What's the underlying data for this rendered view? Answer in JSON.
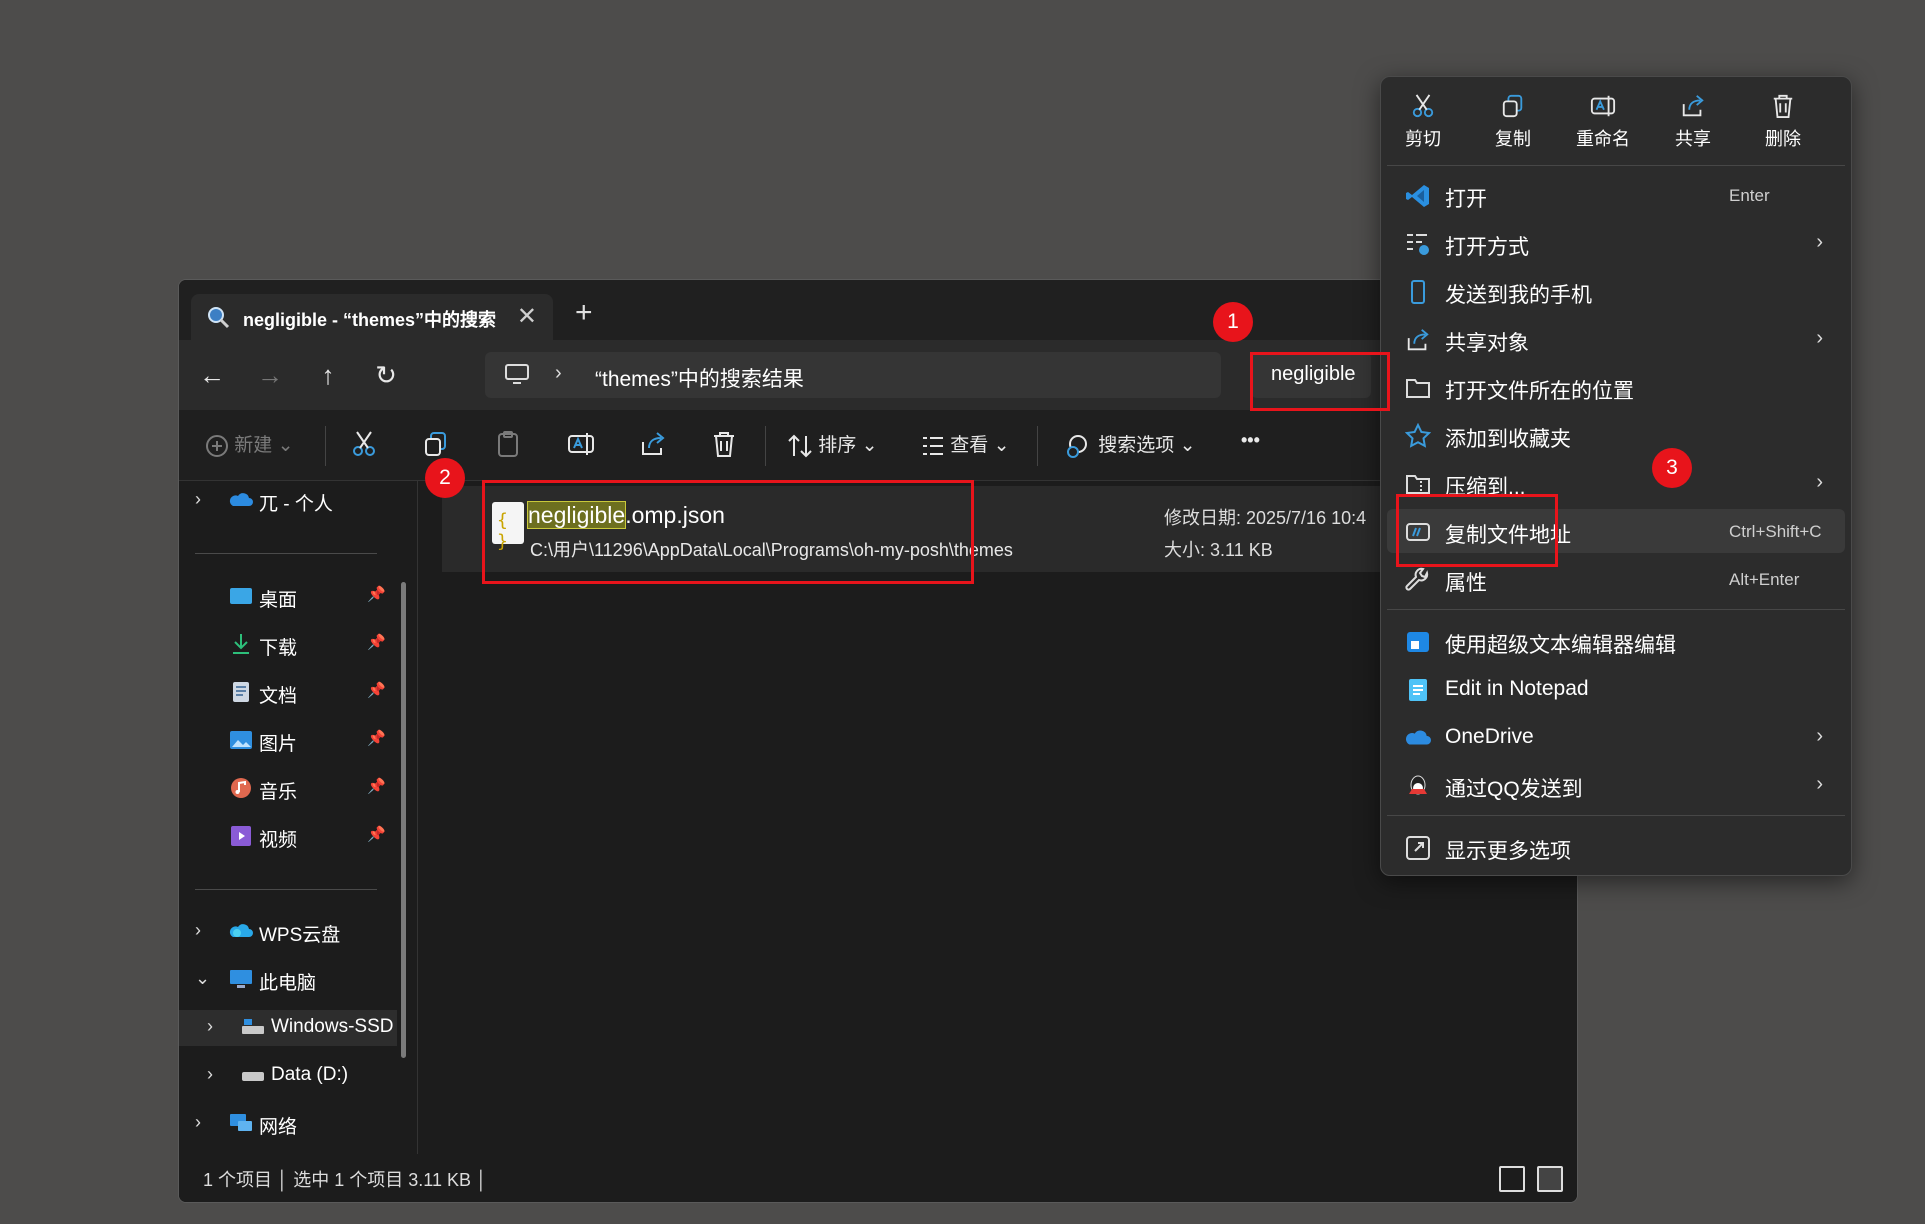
{
  "window": {
    "tab_title": "negligible - “themes”中的搜索",
    "tab_close": "✕",
    "new_tab": "+"
  },
  "nav": {
    "breadcrumb": "“themes”中的搜索结果",
    "search_value": "negligible"
  },
  "toolbar": {
    "new_label": "新建",
    "sort_label": "排序",
    "view_label": "查看",
    "search_options_label": "搜索选项",
    "more_label": "•••"
  },
  "sidebar": {
    "onedrive": "兀 - 个人",
    "pinned": [
      {
        "label": "桌面",
        "icon": "desktop-icon"
      },
      {
        "label": "下载",
        "icon": "download-icon"
      },
      {
        "label": "文档",
        "icon": "document-icon"
      },
      {
        "label": "图片",
        "icon": "picture-icon"
      },
      {
        "label": "音乐",
        "icon": "music-icon"
      },
      {
        "label": "视频",
        "icon": "video-icon"
      }
    ],
    "wps": "WPS云盘",
    "this_pc": "此电脑",
    "drive_c": "Windows-SSD",
    "drive_d": "Data (D:)",
    "network": "网络"
  },
  "result": {
    "name_highlight": "negligible",
    "name_rest": ".omp.json",
    "path": "C:\\用户\\11296\\AppData\\Local\\Programs\\oh-my-posh\\themes",
    "modified": "修改日期: 2025/7/16 10:4",
    "size": "大小: 3.11 KB"
  },
  "status": {
    "text": "1 个项目  │  选中 1 个项目  3.11 KB  │"
  },
  "menu": {
    "quick_actions": [
      "剪切",
      "复制",
      "重命名",
      "共享",
      "删除"
    ],
    "items": [
      {
        "label": "打开",
        "key": "Enter",
        "sub": ""
      },
      {
        "label": "打开方式",
        "key": "",
        "sub": "›"
      },
      {
        "label": "发送到我的手机",
        "key": "",
        "sub": ""
      },
      {
        "label": "共享对象",
        "key": "",
        "sub": "›"
      },
      {
        "label": "打开文件所在的位置",
        "key": "",
        "sub": ""
      },
      {
        "label": "添加到收藏夹",
        "key": "",
        "sub": ""
      },
      {
        "label": "压缩到...",
        "key": "",
        "sub": "›"
      },
      {
        "label": "复制文件地址",
        "key": "Ctrl+Shift+C",
        "sub": ""
      },
      {
        "label": "属性",
        "key": "Alt+Enter",
        "sub": ""
      },
      {
        "label": "使用超级文本编辑器编辑",
        "key": "",
        "sub": ""
      },
      {
        "label": "Edit in Notepad",
        "key": "",
        "sub": ""
      },
      {
        "label": "OneDrive",
        "key": "",
        "sub": "›"
      },
      {
        "label": "通过QQ发送到",
        "key": "",
        "sub": "›"
      },
      {
        "label": "显示更多选项",
        "key": "",
        "sub": ""
      }
    ]
  },
  "annotations": [
    "1",
    "2",
    "3"
  ],
  "colors": {
    "background": "#4d4c4b",
    "window": "#1c1c1c",
    "menu": "#2c2c2c",
    "annotation_red": "#e8141b",
    "search_highlight": "#6d6f1f",
    "accent_blue": "#3a9bdc"
  }
}
